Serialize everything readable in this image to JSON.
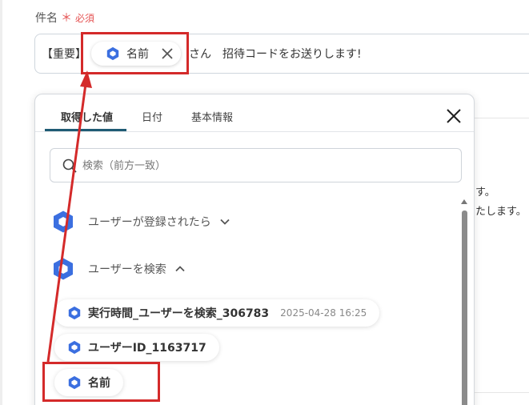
{
  "field": {
    "label": "件名",
    "required_mark": "＊",
    "required_text": "必須"
  },
  "subject": {
    "prefix": "【重要】",
    "chip_label": "名前",
    "suffix": "さん　招待コードをお送りします!"
  },
  "background": {
    "line1_tail": "す。",
    "line2_tail": "たします。"
  },
  "panel": {
    "tabs": [
      {
        "label": "取得した値",
        "active": true
      },
      {
        "label": "日付",
        "active": false
      },
      {
        "label": "基本情報",
        "active": false
      }
    ],
    "search_placeholder": "検索（前方一致）",
    "groups": [
      {
        "label": "ユーザーが登録されたら",
        "expanded": false
      },
      {
        "label": "ユーザーを検索",
        "expanded": true
      }
    ],
    "items": [
      {
        "label": "実行時間_ユーザーを検索_306783",
        "timestamp": "2025-04-28 16:25"
      },
      {
        "label": "ユーザーID_1163717",
        "timestamp": ""
      },
      {
        "label": "名前",
        "timestamp": ""
      }
    ]
  },
  "colors": {
    "highlight": "#d42a2a",
    "icon_blue": "#3b6fe0",
    "required": "#e55353",
    "tab_underline": "#1f5b74"
  },
  "icons": {
    "chip": "hexagon-icon",
    "close": "close-icon",
    "search": "search-icon",
    "chevron_down": "chevron-down-icon",
    "chevron_up": "chevron-up-icon"
  }
}
